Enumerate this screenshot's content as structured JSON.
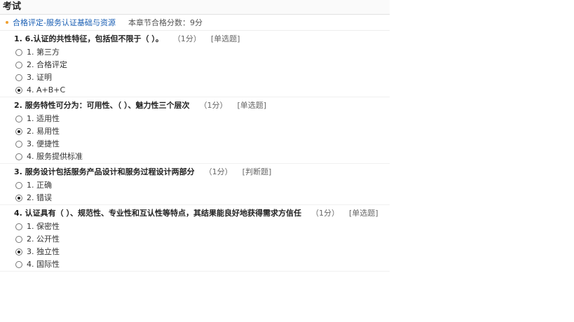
{
  "page": {
    "title": "考试"
  },
  "section": {
    "name": "合格评定-服务认证基础与资源",
    "pass_score": "本章节合格分数：9分"
  },
  "questions": [
    {
      "title": "1. 6.认证的共性特征，包括但不限于（ ）。",
      "score": "（1分）",
      "type": "[单选题]",
      "options": [
        {
          "label": "1. 第三方",
          "selected": false
        },
        {
          "label": "2. 合格评定",
          "selected": false
        },
        {
          "label": "3. 证明",
          "selected": false
        },
        {
          "label": "4. A+B+C",
          "selected": true
        }
      ]
    },
    {
      "title": "2. 服务特性可分为：可用性、（ ）、魅力性三个层次",
      "score": "（1分）",
      "type": "[单选题]",
      "options": [
        {
          "label": "1. 适用性",
          "selected": false
        },
        {
          "label": "2. 易用性",
          "selected": true
        },
        {
          "label": "3. 便捷性",
          "selected": false
        },
        {
          "label": "4. 服务提供标准",
          "selected": false
        }
      ]
    },
    {
      "title": "3. 服务设计包括服务产品设计和服务过程设计两部分",
      "score": "（1分）",
      "type": "[判断题]",
      "options": [
        {
          "label": "1. 正确",
          "selected": false
        },
        {
          "label": "2. 错误",
          "selected": true
        }
      ]
    },
    {
      "title": "4. 认证具有（ ）、规范性、专业性和互认性等特点，其结果能良好地获得需求方信任",
      "score": "（1分）",
      "type": "[单选题]",
      "options": [
        {
          "label": "1. 保密性",
          "selected": false
        },
        {
          "label": "2. 公开性",
          "selected": false
        },
        {
          "label": "3. 独立性",
          "selected": true
        },
        {
          "label": "4. 国际性",
          "selected": false
        }
      ]
    }
  ]
}
